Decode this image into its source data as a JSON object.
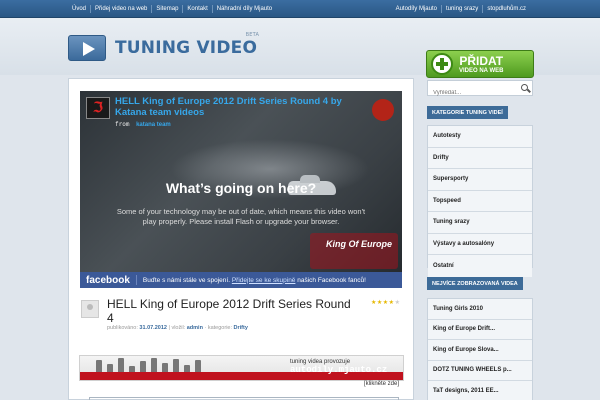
{
  "topnav": {
    "left": [
      "Úvod",
      "Přidej video na web",
      "Sitemap",
      "Kontakt",
      "Náhradní díly Mjauto"
    ],
    "right": [
      "Autodíly Mjauto",
      "tuning srazy",
      "stopdluhům.cz"
    ]
  },
  "header": {
    "logo_text": "TUNING VIDEO",
    "logo_badge": "BETA",
    "add_button_line1": "PŘIDAT",
    "add_button_line2": "VIDEO NA WEB"
  },
  "video": {
    "title": "HELL King of Europe 2012 Drift Series Round 4 by Katana team videos",
    "from_label": "from",
    "from_user": "katana team",
    "heading": "What’s going on here?",
    "message": "Some of your technology may be out of date, which means this video won't play properly. Please install Flash or upgrade your browser.",
    "badge": "King Of Europe",
    "thumb_glyph": "ℑ"
  },
  "facebook": {
    "logo": "facebook",
    "text": "Buďte s námi stále ve spojení.",
    "link": "Přidejte se ke skupině",
    "text_after": "našich Facebook fanců!"
  },
  "post": {
    "title": "HELL King of Europe 2012 Drift Series Round 4",
    "published_label": "publikováno:",
    "date": "31.07.2012",
    "added_label": "vložil:",
    "author": "admin",
    "category_label": "kategorie:",
    "category": "Drifty",
    "rating": 4,
    "rating_max": 5
  },
  "ad": {
    "line1": "tuning videa provozuje",
    "line2": "autodily.mjauto.cz",
    "click": "[klikněte zde]"
  },
  "search": {
    "placeholder": "Vyhledat..."
  },
  "sidebar": {
    "categories_title": "KATEGORIE TUNING VIDEÍ",
    "categories": [
      "Autotesty",
      "Drifty",
      "Supersporty",
      "Topspeed",
      "Tuning srazy",
      "Výstavy a autosalóny",
      "Ostatní"
    ],
    "popular_title": "NEJVÍCE ZOBRAZOVANÁ VIDEA",
    "popular": [
      "Tuning Girls 2010",
      "King of Europe Drift...",
      "King of Europe Slova...",
      "DOTZ TUNING WHEELS p...",
      "TaT designs, 2011 EE..."
    ]
  },
  "colors": {
    "nav_blue": "#2a5784",
    "accent_blue": "#3a6b9d",
    "add_green": "#4e9a1f",
    "facebook_blue": "#3b5998",
    "ad_red": "#c0121e"
  }
}
